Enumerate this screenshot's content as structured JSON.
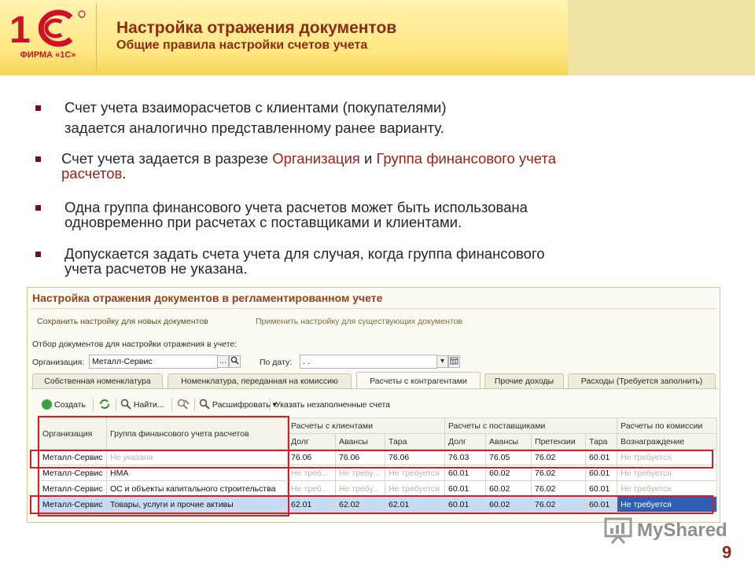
{
  "header": {
    "logo_caption": "ФИРМА «1С»",
    "title": "Настройка отражения документов",
    "subtitle": "Общие правила настройки счетов учета"
  },
  "bullets": {
    "b1_line1": "Счет учета взаиморасчетов с клиентами (покупателями)",
    "b1_line2": "задается аналогично представленному ранее варианту.",
    "b2_pre": "Счет учета задается в разрезе ",
    "b2_hl1": "Организация",
    "b2_mid": " и ",
    "b2_hl2": "Группа финансового учета",
    "b2_hl3": "расчетов",
    "b2_end": ".",
    "b3_line1": "Одна группа финансового учета расчетов может быть использована",
    "b3_line2": "одновременно при расчетах с поставщиками и клиентами.",
    "b4_line1": "Допускается задать счета учета для случая, когда группа финансового",
    "b4_line2": "учета расчетов не указана."
  },
  "window": {
    "title": "Настройка отражения документов в регламентированном учете",
    "cmd_save": "Сохранить настройку для новых документов",
    "cmd_apply": "Применить настройку для существующих документов",
    "filter_label": "Отбор документов для настройки отражения в учете:",
    "org_label": "Организация:",
    "org_value": "Металл-Сервис",
    "date_label": "По дату:",
    "date_value": ". .",
    "tabs": [
      "Собственная номенклатура",
      "Номенклатура, переданная на комиссию",
      "Расчеты с контрагентами",
      "Прочие доходы",
      "Расходы (Требуется заполнить)"
    ],
    "toolbar": {
      "create": "Создать",
      "find": "Найти...",
      "decode": "Расшифровать",
      "fill_empty": "Указать незаполненные счета"
    },
    "table": {
      "h_org": "Организация",
      "h_group": "Группа финансового учета расчетов",
      "h_clients": "Расчеты с клиентами",
      "h_suppliers": "Расчеты с поставщиками",
      "h_commission": "Расчеты по комиссии",
      "sub": [
        "Долг",
        "Авансы",
        "Тара",
        "Долг",
        "Авансы",
        "Претензии",
        "Тара",
        "Вознаграждение"
      ],
      "rows": [
        [
          "Металл-Сервис",
          "Не указана",
          "76.06",
          "76.06",
          "76.06",
          "76.03",
          "76.05",
          "76.02",
          "60.01",
          "Не требуется"
        ],
        [
          "Металл-Сервис",
          "НМА",
          "Не треб...",
          "Не требу...",
          "Не требуется",
          "60.01",
          "60.02",
          "76.02",
          "60.01",
          "Не требуется"
        ],
        [
          "Металл-Сервис",
          "ОС и объекты капитального строительства",
          "Не треб...",
          "Не требу...",
          "Не требуется",
          "60.01",
          "60.02",
          "76.02",
          "60.01",
          "Не требуется"
        ],
        [
          "Металл-Сервис",
          "Товары, услуги и прочие активы",
          "62.01",
          "62.02",
          "62.01",
          "60.01",
          "60.02",
          "76.02",
          "60.01",
          "Не требуется"
        ]
      ]
    }
  },
  "watermark": "MyShared",
  "page_number": "9",
  "colors": {
    "title": "#8d2b15",
    "accent_red": "#d41d28",
    "highlight": "#a0201a",
    "selection": "#c6dcf3"
  }
}
